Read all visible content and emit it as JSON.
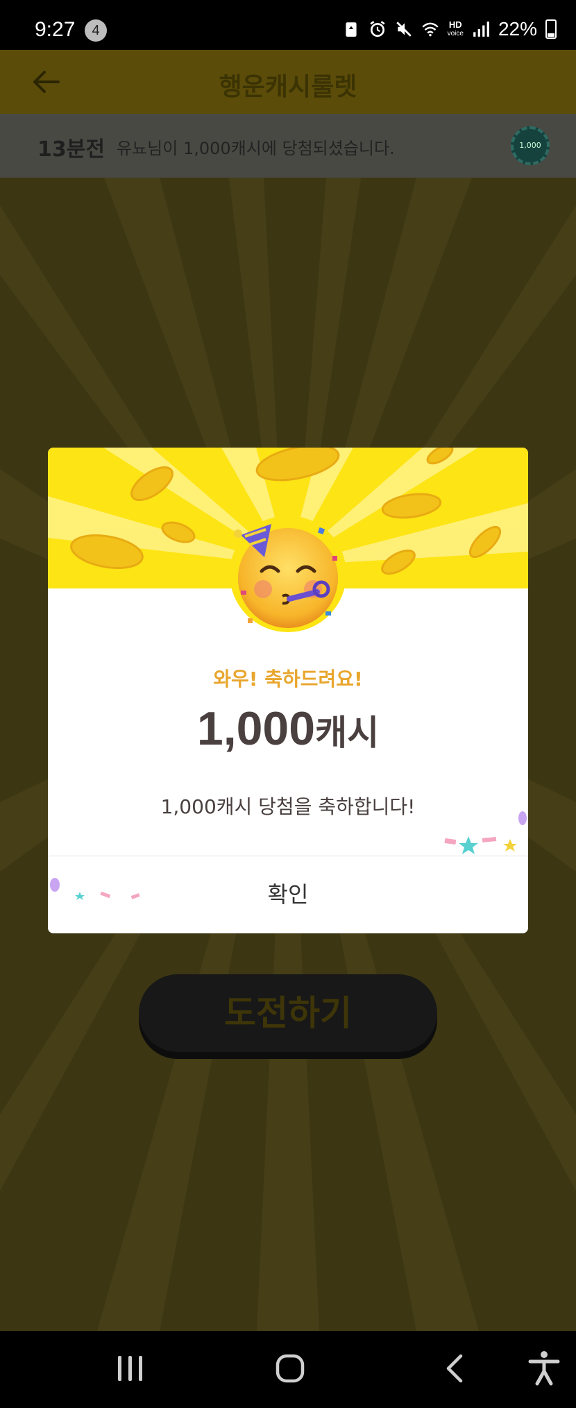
{
  "status_bar": {
    "time": "9:27",
    "notification_count": "4",
    "hd_label": "HD",
    "voice_label": "voice",
    "battery": "22%"
  },
  "header": {
    "title": "행운캐시룰렛"
  },
  "ticker": {
    "time_ago": "13분전",
    "message": "유뇨님이 1,000캐시에 당첨되셨습니다.",
    "chip_value": "1,000"
  },
  "main": {
    "challenge_label": "도전하기"
  },
  "dialog": {
    "congrats": "와우! 축하드려요!",
    "amount": "1,000",
    "amount_unit": "캐시",
    "message": "1,000캐시 당첨을 축하합니다!",
    "confirm_label": "확인",
    "emoji": "partying-face-emoji"
  },
  "colors": {
    "accent_yellow": "#fde414",
    "congrats_text": "#e8a62d",
    "amount_text": "#4b4040"
  }
}
